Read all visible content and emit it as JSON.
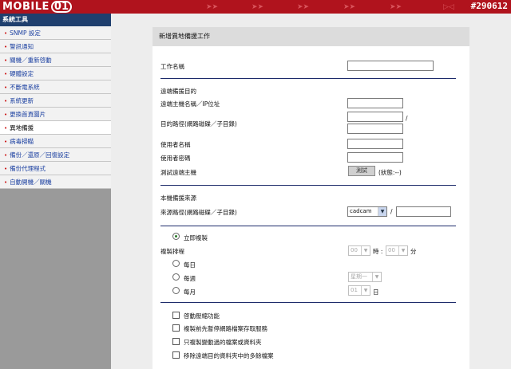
{
  "header": {
    "logo_text": "MOBILE",
    "logo_num": "01",
    "watermark": "#290612"
  },
  "sidebar": {
    "title": "系統工具",
    "items": [
      {
        "label": "SNMP 設定",
        "active": false
      },
      {
        "label": "警訊通知",
        "active": false
      },
      {
        "label": "關機／重新啓動",
        "active": false
      },
      {
        "label": "硬體設定",
        "active": false
      },
      {
        "label": "不斷電系統",
        "active": false
      },
      {
        "label": "系統更新",
        "active": false
      },
      {
        "label": "更換首頁圖片",
        "active": false
      },
      {
        "label": "異地備援",
        "active": true
      },
      {
        "label": "病毒掃瞄",
        "active": false
      },
      {
        "label": "備份／還原／回復設定",
        "active": false
      },
      {
        "label": "備份代理程式",
        "active": false
      },
      {
        "label": "自動開機／關機",
        "active": false
      }
    ]
  },
  "form": {
    "panel_title": "新增異地備援工作",
    "task_name_label": "工作名稱",
    "remote_section_label": "遠端備援目的",
    "remote_host_label": "遠端主機名稱／IP位址",
    "dest_path_label": "目的路徑(網路磁碟／子目錄)",
    "slash": "/",
    "username_label": "使用者名稱",
    "password_label": "使用者密碼",
    "test_host_label": "測試遠端主機",
    "test_button": "測試",
    "test_status": "(狀態:--)",
    "local_section_label": "本機備援來源",
    "source_path_label": "來源路徑(網路磁碟／子目錄)",
    "source_share": "cadcam",
    "immediate_copy_label": "立即複製",
    "schedule_label": "複製排程",
    "hour_value": "00",
    "hour_unit": "時 :",
    "minute_value": "00",
    "minute_unit": "分",
    "daily_label": "每日",
    "weekly_label": "每週",
    "weekday_value": "星期一",
    "monthly_label": "每月",
    "day_value": "01",
    "day_unit": "日",
    "compress_label": "啓動壓縮功能",
    "pause_service_label": "複製前先暫停網路檔案存取服務",
    "changed_only_label": "只複製變動過的檔案或資料夾",
    "remove_extra_label": "移除遠端目的資料夾中的多餘檔案"
  }
}
